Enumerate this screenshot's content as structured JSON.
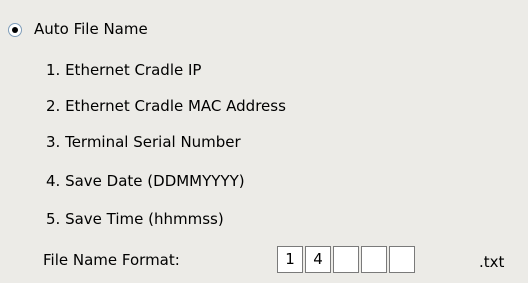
{
  "auto_file_name": {
    "label": "Auto File Name",
    "selected": true
  },
  "options": [
    "1. Ethernet Cradle IP",
    "2. Ethernet Cradle MAC Address",
    "3. Terminal Serial Number",
    "4. Save Date (DDMMYYYY)",
    "5. Save Time (hhmmss)"
  ],
  "file_name_format": {
    "label": "File Name Format:",
    "fields": [
      "1",
      "4",
      "",
      "",
      ""
    ],
    "extension": ".txt"
  }
}
